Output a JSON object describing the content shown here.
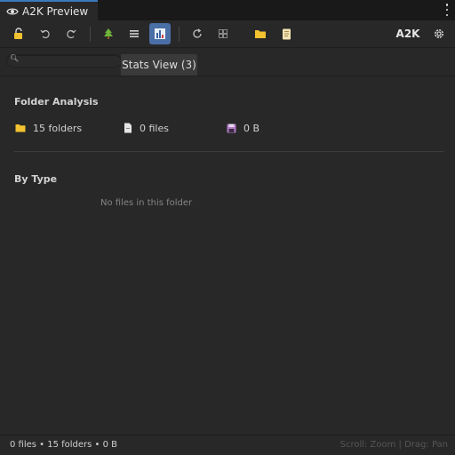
{
  "window": {
    "tab_title": "A2K Preview"
  },
  "toolbar": {
    "buttons": [
      {
        "name": "unlock-icon"
      },
      {
        "name": "undo-icon"
      },
      {
        "name": "redo-icon"
      },
      {
        "name": "tree-icon"
      },
      {
        "name": "list-icon"
      },
      {
        "name": "stats-icon",
        "active": true
      },
      {
        "name": "refresh-icon"
      },
      {
        "name": "grid-icon"
      },
      {
        "name": "folder-icon"
      },
      {
        "name": "document-icon"
      },
      {
        "name": "gear-icon"
      }
    ],
    "brand_label": "A2K"
  },
  "search": {
    "value": "",
    "placeholder": ""
  },
  "view_tab": {
    "label": "Stats View (3)"
  },
  "folder_analysis": {
    "title": "Folder Analysis",
    "folders": "15 folders",
    "files": "0 files",
    "size": "0 B"
  },
  "by_type": {
    "title": "By Type",
    "empty_message": "No files in this folder"
  },
  "status": {
    "summary": "0 files • 15 folders • 0 B",
    "hint": "Scroll: Zoom | Drag: Pan"
  },
  "colors": {
    "accent": "#3a79bb",
    "active_button": "#4a6fa6",
    "folder_yellow": "#f2c230",
    "tree_green": "#6fb33a",
    "disk_purple": "#b37ac6"
  }
}
